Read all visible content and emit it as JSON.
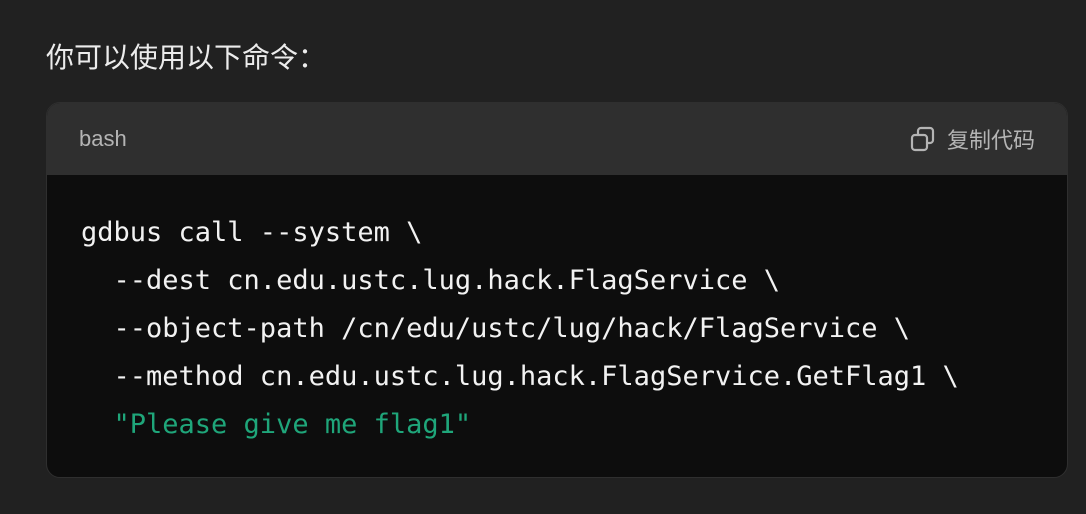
{
  "intro_text": "你可以使用以下命令：",
  "code_block": {
    "language": "bash",
    "copy_label": "复制代码",
    "copy_icon": "copy-icon",
    "lines": [
      "gdbus call --system \\",
      "  --dest cn.edu.ustc.lug.hack.FlagService \\",
      "  --object-path /cn/edu/ustc/lug/hack/FlagService \\",
      "  --method cn.edu.ustc.lug.hack.FlagService.GetFlag1 \\"
    ],
    "string_line": "  \"Please give me flag1\"",
    "string_color": "#1fa67a"
  }
}
